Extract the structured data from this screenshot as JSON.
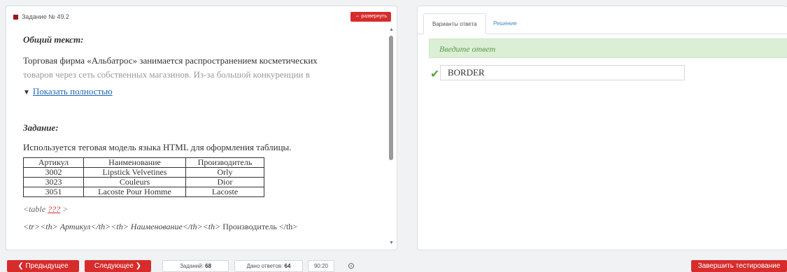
{
  "left_panel": {
    "task_label": "Задание № 49.2",
    "expand_button": "⇔ развернуть",
    "general_heading": "Общий текст:",
    "general_text_line1": "Торговая фирма «Альбатрос» занимается распространением косметических",
    "general_text_line2": "товаров через сеть собственных магазинов. Из-за большой конкуренции в",
    "show_more": "Показать полностью",
    "task_heading": "Задание:",
    "task_text": "Используется теговая модель языка HTML для оформления таблицы.",
    "table": {
      "headers": [
        "Артикул",
        "Наименование",
        "Производитель"
      ],
      "rows": [
        [
          "3002",
          "Lipstick Velvetines",
          "Orly"
        ],
        [
          "3023",
          "Couleurs",
          "Dior"
        ],
        [
          "3051",
          "Lacoste Pour Homme",
          "Lacoste"
        ]
      ]
    },
    "code_line1_prefix": "<table ",
    "code_line1_blank": "???",
    "code_line1_suffix": " >",
    "code_line2_italic": "<tr><th> Артикул</th><th> Наименование</th><th>",
    "code_line2_normal": " Производитель </th>"
  },
  "right_panel": {
    "tab_answers": "Варианты ответа",
    "tab_solution": "Решение",
    "banner": "Введите ответ",
    "answer_value": "BORDER"
  },
  "bottom_bar": {
    "prev_label": "❮ Предыдущее",
    "next_label": "Следующее ❯",
    "tasks_label": "Заданий:",
    "tasks_value": "68",
    "answers_label": "Дано ответов:",
    "answers_value": "64",
    "time": "90:20",
    "finish_label": "Завершить тестирование"
  },
  "colors": {
    "accent_red": "#d62c2c",
    "banner_green": "#dbeed6",
    "link_blue": "#1f66b3"
  }
}
